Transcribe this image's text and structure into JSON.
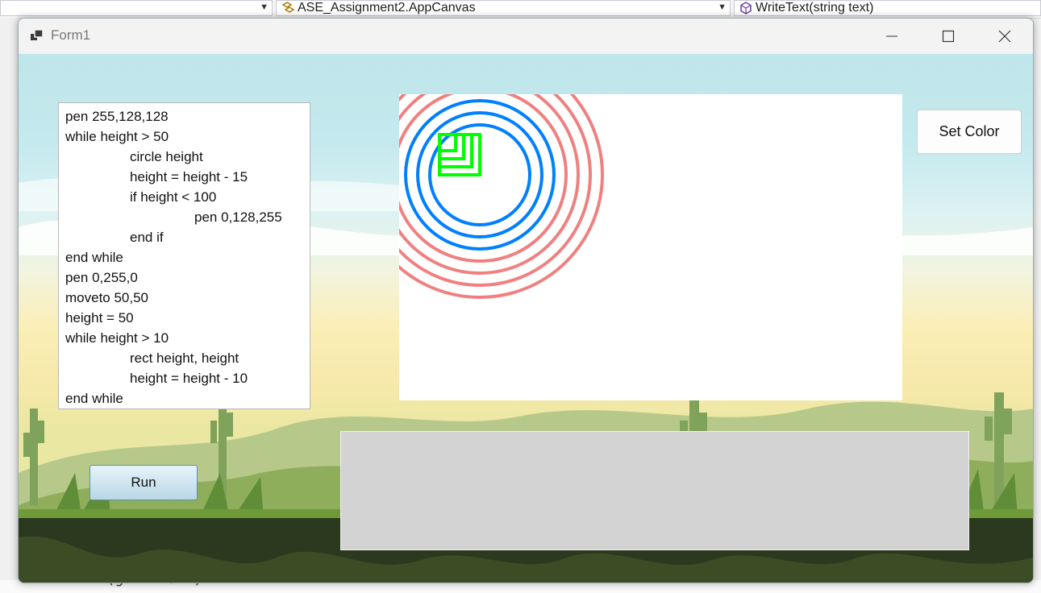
{
  "ide": {
    "class_dropdown": "ASE_Assignment2.AppCanvas",
    "member_dropdown": "WriteText(string text)",
    "code_fragment": "if(g != null)"
  },
  "window": {
    "title": "Form1",
    "minimize_glyph": "—",
    "maximize_glyph": "☐",
    "close_glyph": "✕"
  },
  "editor": {
    "lines": [
      "pen 255,128,128",
      "while height > 50",
      "circle height",
      "height = height - 15",
      "if height < 100",
      "pen 0,128,255",
      "end if",
      "end while",
      "pen 0,255,0",
      "moveto 50,50",
      "height = 50",
      "while height > 10",
      "rect height, height",
      "height = height - 10",
      "end while"
    ]
  },
  "buttons": {
    "set_color": "Set Color",
    "run": "Run"
  },
  "drawing": {
    "pink": "#f08080",
    "blue": "#0080ff",
    "green": "#00ff00"
  }
}
